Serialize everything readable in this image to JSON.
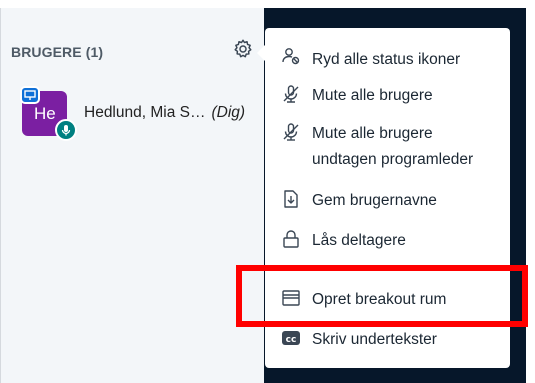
{
  "users_panel": {
    "header": "BRUGERE (1)",
    "user": {
      "avatar_initials": "He",
      "name": "Hedlund, Mia S…",
      "tag": "(Dig)"
    }
  },
  "options_menu": {
    "items": [
      {
        "label": "Ryd alle status ikoner",
        "icon": "clear-status-icon"
      },
      {
        "label": "Mute alle brugere",
        "icon": "mute-icon"
      },
      {
        "label": "Mute alle brugere",
        "label2": "undtagen programleder",
        "icon": "mute-icon"
      },
      {
        "label": "Gem brugernavne",
        "icon": "download-icon"
      },
      {
        "label": "Lås deltagere",
        "icon": "lock-icon"
      },
      {
        "label": "Opret breakout rum",
        "icon": "breakout-room-icon"
      },
      {
        "label": "Skriv undertekster",
        "icon": "closed-caption-icon"
      }
    ]
  },
  "colors": {
    "dark_panel": "#06172a",
    "avatar": "#7b1fa2",
    "presenter_badge": "#0f70d7",
    "mic_badge": "#008081",
    "highlight": "#ff0000"
  }
}
